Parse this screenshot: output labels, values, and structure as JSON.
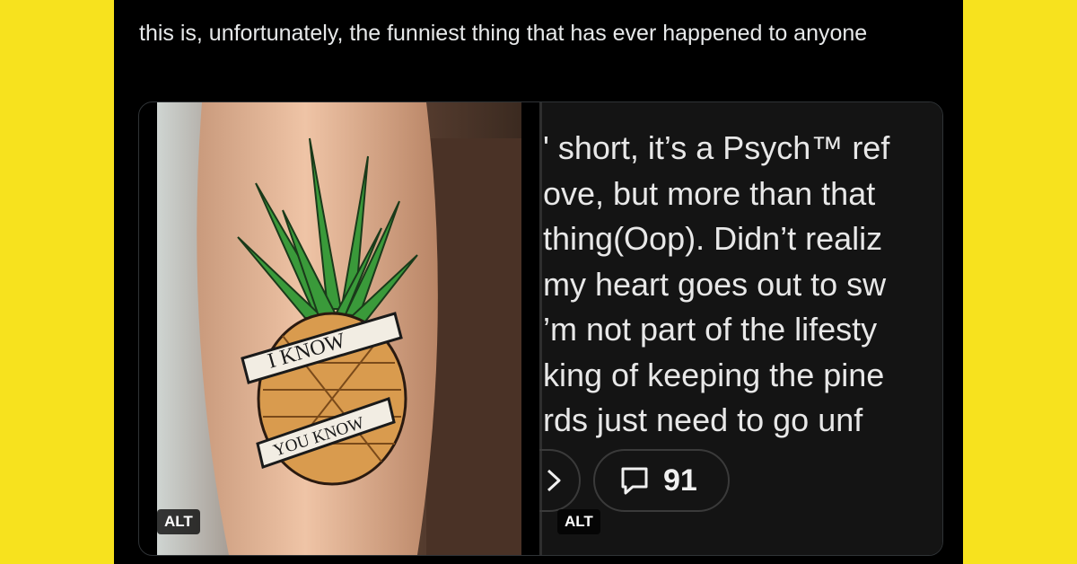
{
  "tweet": {
    "text": "this is, unfortunately, the funniest thing that has ever happened to anyone"
  },
  "media": {
    "image_left": {
      "tattoo_banner_top": "I KNOW",
      "tattoo_banner_bottom": "YOU KNOW",
      "alt_label": "ALT"
    },
    "image_right": {
      "lines": [
        "' short, it’s a Psych™ ref",
        "ove, but more than that",
        "thing(Oop). Didn’t realiz",
        "my heart goes out to sw",
        "’m not part of the lifesty",
        "king of keeping the pine",
        "rds just need to go unf"
      ],
      "comment_count": "91",
      "alt_label": "ALT"
    }
  },
  "colors": {
    "page_background": "#f7e21e",
    "tweet_background": "#000000",
    "tweet_text": "#e7e9ea"
  },
  "icons": [
    "comment-icon",
    "share-icon"
  ]
}
